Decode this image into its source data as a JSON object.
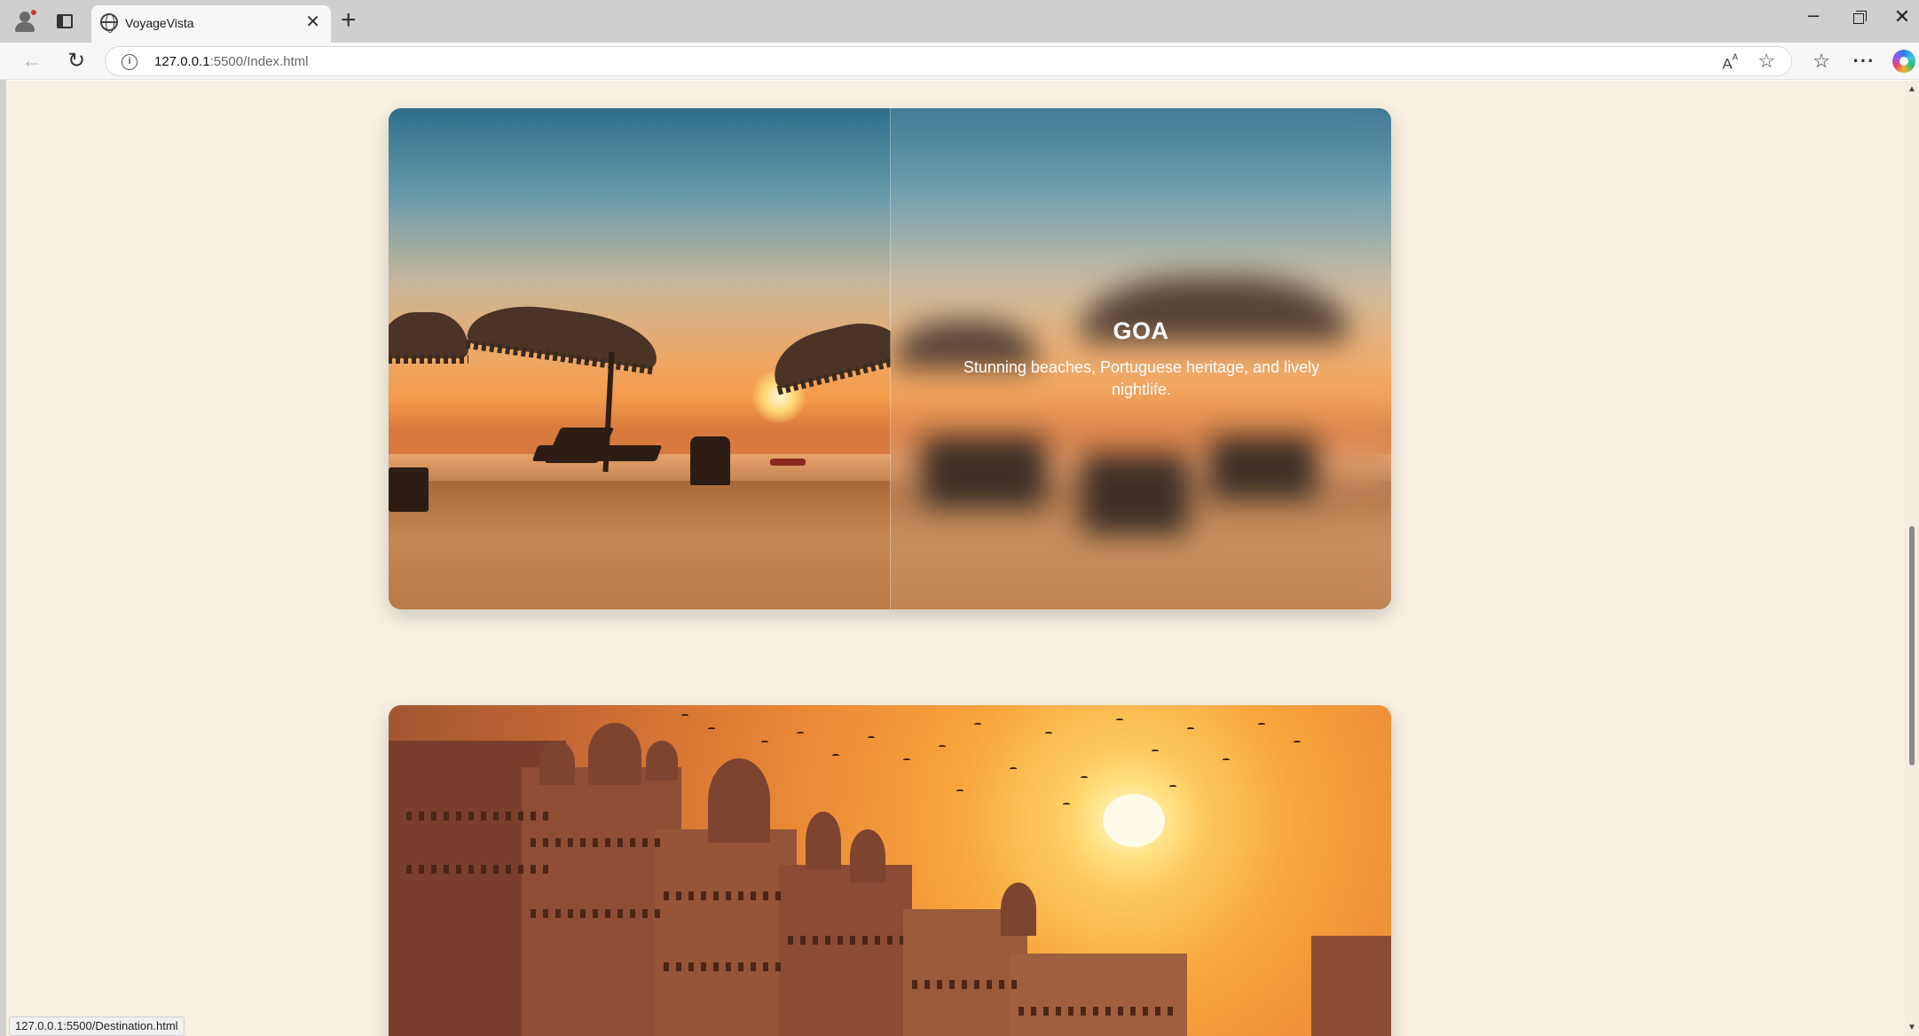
{
  "browser": {
    "tab_title": "VoyageVista",
    "url_host": "127.0.0.1",
    "url_path": ":5500/Index.html",
    "status_url": "127.0.0.1:5500/Destination.html"
  },
  "destinations": [
    {
      "name": "GOA",
      "description": "Stunning beaches, Portuguese heritage, and lively nightlife."
    }
  ],
  "colors": {
    "page_bg": "#f8f1e3",
    "text_on_card": "#ffffff"
  },
  "icons": {
    "profile": "profile-icon",
    "tab_actions": "tab-actions-icon",
    "site": "globe-icon",
    "close_tab": "close-icon",
    "new_tab": "plus-icon",
    "back": "back-arrow-icon",
    "reload": "reload-icon",
    "site_info": "info-icon",
    "read_aloud": "read-aloud-icon",
    "favorite": "star-icon",
    "favorites": "favorites-icon",
    "more": "more-icon",
    "copilot": "copilot-icon"
  }
}
